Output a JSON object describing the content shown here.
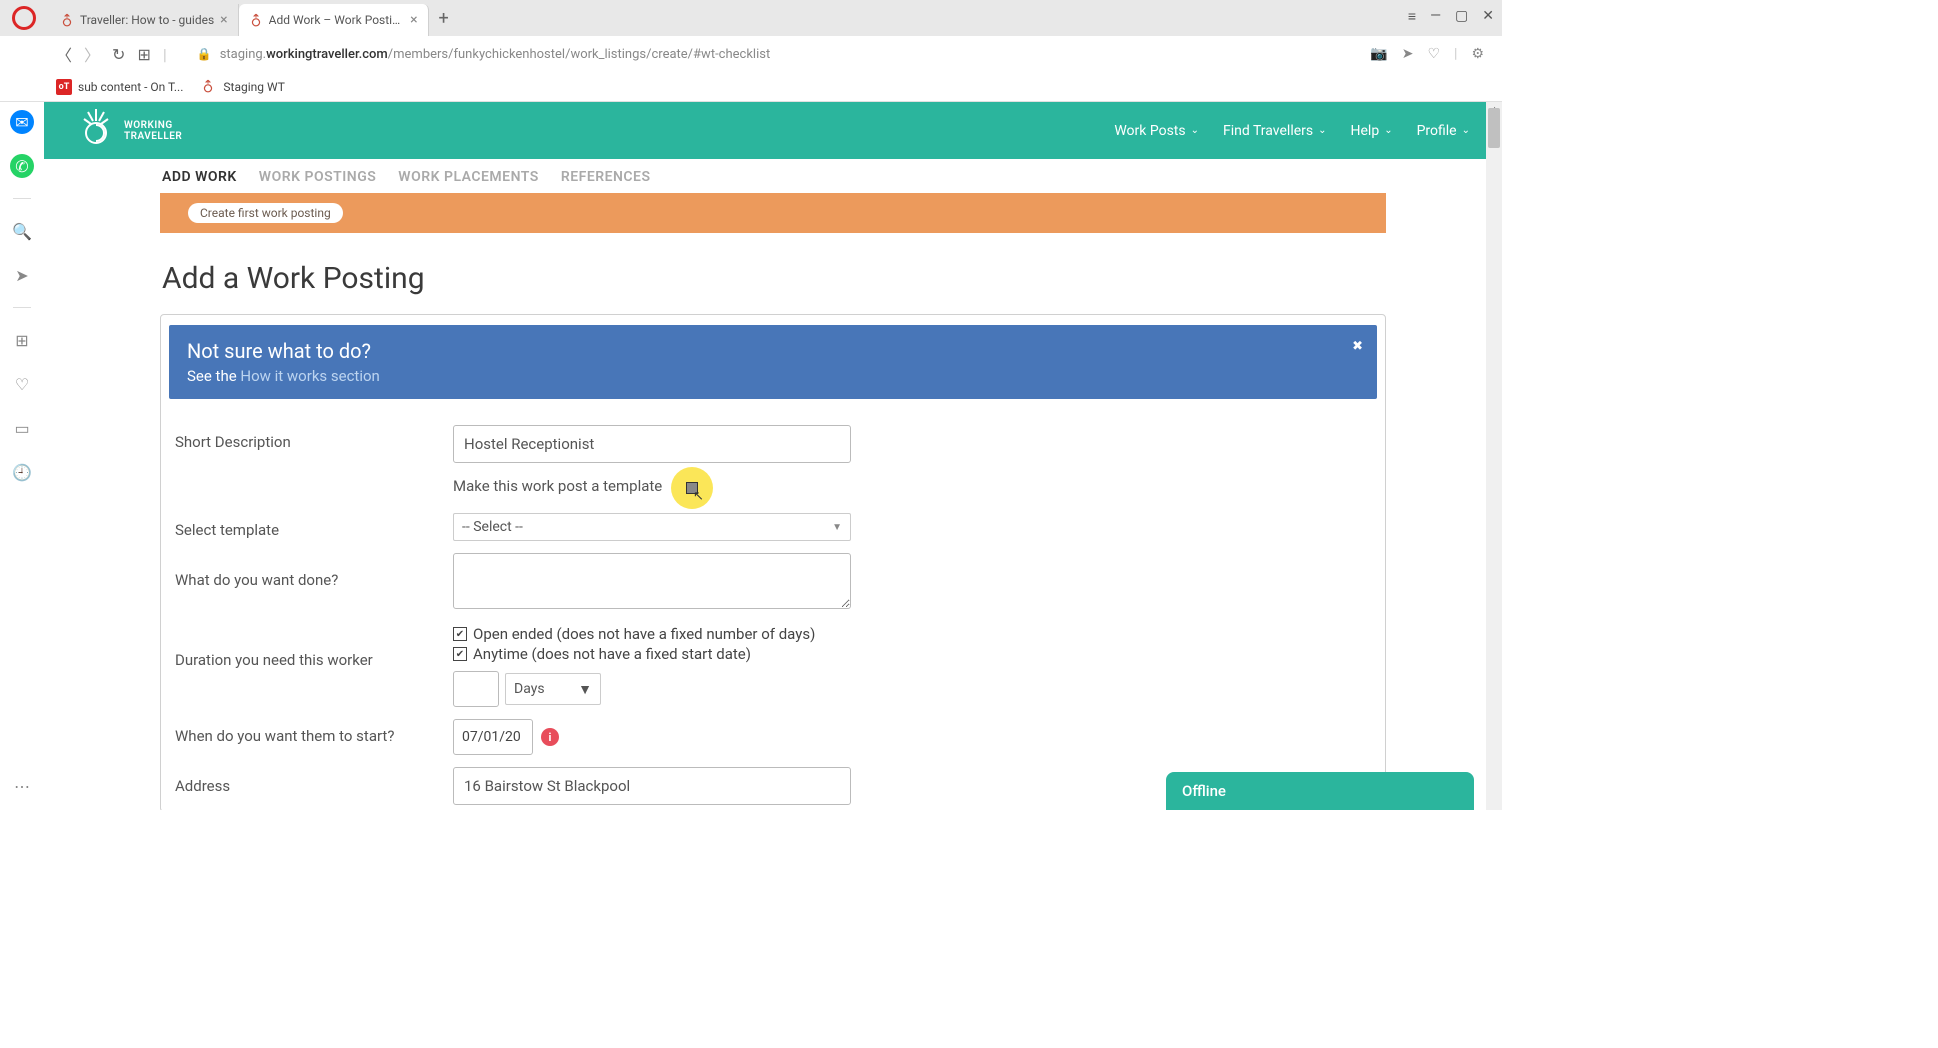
{
  "browser": {
    "tabs": [
      {
        "title": "Traveller: How to - guides",
        "active": false
      },
      {
        "title": "Add Work – Work Postings",
        "active": true
      }
    ],
    "url_prefix": "staging.",
    "url_domain": "workingtraveller.com",
    "url_path": "/members/funkychickenhostel/work_listings/create/#wt-checklist",
    "bookmarks": [
      {
        "label": "sub content - On T...",
        "icon": "ot"
      },
      {
        "label": "Staging WT",
        "icon": "wt"
      }
    ]
  },
  "site": {
    "logo_line1": "WORKING",
    "logo_line2": "TRAVELLER",
    "nav": [
      {
        "label": "Work Posts"
      },
      {
        "label": "Find Travellers"
      },
      {
        "label": "Help"
      },
      {
        "label": "Profile"
      }
    ]
  },
  "page_tabs": [
    {
      "label": "ADD WORK",
      "active": true
    },
    {
      "label": "WORK POSTINGS"
    },
    {
      "label": "WORK PLACEMENTS"
    },
    {
      "label": "REFERENCES"
    }
  ],
  "orange_banner_button": "Create first work posting",
  "page_title": "Add a Work Posting",
  "alert": {
    "title": "Not sure what to do?",
    "sub_prefix": "See the ",
    "link": "How it works section"
  },
  "form": {
    "short_desc_label": "Short Description",
    "short_desc_value": "Hostel Receptionist",
    "template_checkbox_label": "Make this work post a template",
    "select_template_label": "Select template",
    "select_template_value": "-- Select --",
    "what_done_label": "What do you want done?",
    "duration_label": "Duration you need this worker",
    "open_ended_label": "Open ended (does not have a fixed number of days)",
    "anytime_label": "Anytime (does not have a fixed start date)",
    "days_label": "Days",
    "when_start_label": "When do you want them to start?",
    "when_start_value": "07/01/20",
    "address_label": "Address",
    "address_value": "16 Bairstow St Blackpool"
  },
  "chat": {
    "status": "Offline"
  }
}
